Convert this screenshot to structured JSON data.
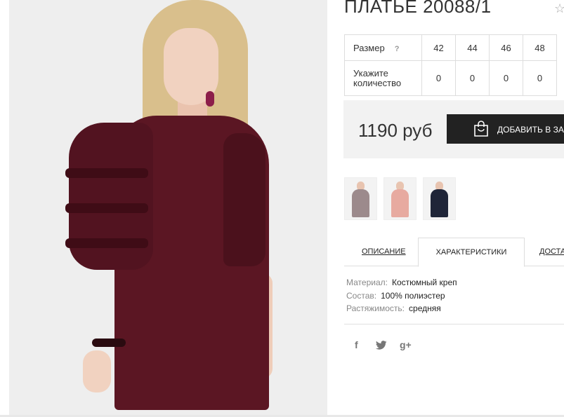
{
  "product": {
    "title": "ПЛАТЬЕ 20088/1",
    "favorite_icon": "star-outline-icon"
  },
  "sizes": {
    "size_label": "Размер",
    "help_mark": "?",
    "sizes": [
      "42",
      "44",
      "46",
      "48"
    ],
    "qty_label": "Укажите количество",
    "quantities": [
      "0",
      "0",
      "0",
      "0"
    ]
  },
  "purchase": {
    "price": "1190 руб",
    "add_button_label": "ДОБАВИТЬ В ЗАКАЗ",
    "button_icon": "shopping-bag-icon"
  },
  "thumbnails": [
    {
      "name": "burgundy"
    },
    {
      "name": "pink"
    },
    {
      "name": "navy"
    }
  ],
  "tabs": [
    {
      "label": "ОПИСАНИЕ",
      "active": false
    },
    {
      "label": "ХАРАКТЕРИСТИКИ",
      "active": true
    },
    {
      "label": "ДОСТАВКА",
      "active": false
    }
  ],
  "characteristics": [
    {
      "key": "Материал:",
      "value": "Костюмный креп"
    },
    {
      "key": "Состав:",
      "value": "100% полиэстер"
    },
    {
      "key": "Растяжимость:",
      "value": "средняя"
    }
  ],
  "social": {
    "facebook": "f",
    "twitter": "twitter-icon",
    "googleplus": "g+"
  },
  "colors": {
    "dress": "#5b1623",
    "button_bg": "#222222",
    "price_bg": "#f2f2f2"
  }
}
